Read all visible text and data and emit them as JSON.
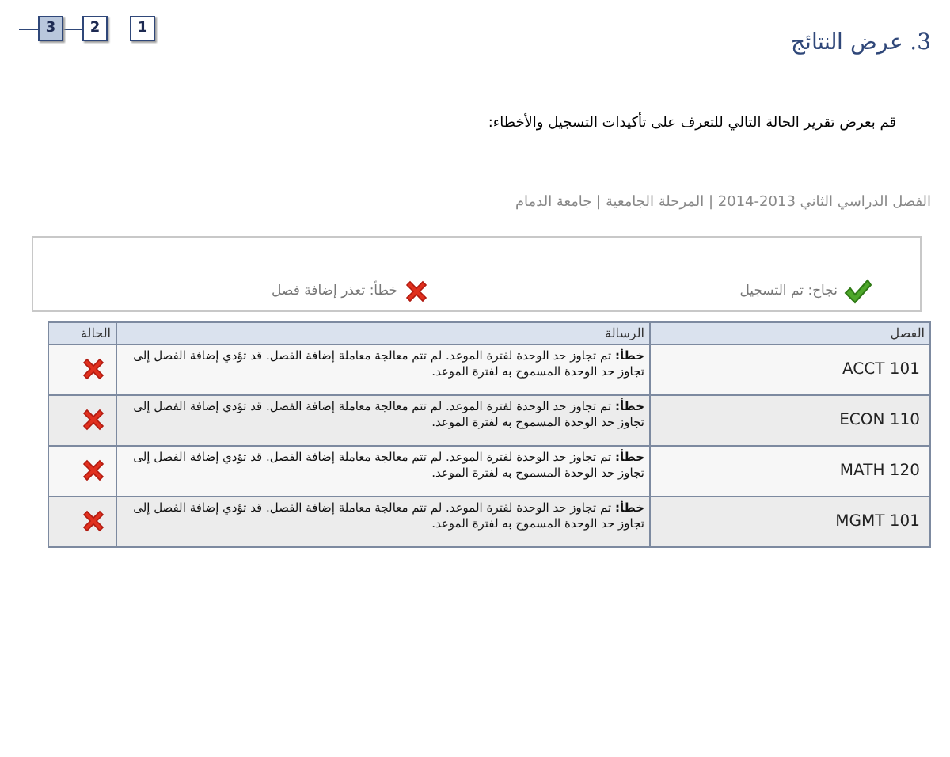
{
  "steps": [
    {
      "label": "1",
      "selected": false
    },
    {
      "label": "2",
      "selected": false
    },
    {
      "label": "3",
      "selected": true
    }
  ],
  "title": "3. عرض النتائج",
  "instruction": "قم بعرض تقرير الحالة التالي للتعرف على تأكيدات التسجيل والأخطاء:",
  "breadcrumb": "الفصل الدراسي الثاني 2013-2014 | المرحلة الجامعية | جامعة الدمام",
  "legend": [
    {
      "kind": "success",
      "text": "نجاح: تم التسجيل"
    },
    {
      "kind": "error",
      "text": "خطأ: تعذر إضافة فصل"
    }
  ],
  "table": {
    "columns": [
      "الفصل",
      "الرسالة",
      "الحالة"
    ],
    "rows": [
      {
        "class": "ACCT  101",
        "message": "**خطأ:** تم تجاوز حد الوحدة لفترة الموعد. لم تتم معالجة معاملة إضافة الفصل. قد تؤدي إضافة الفصل إلى تجاوز حد الوحدة المسموح به لفترة الموعد.",
        "kind": "error"
      },
      {
        "class": "ECON  110",
        "message": "**خطأ:** تم تجاوز حد الوحدة لفترة الموعد. لم تتم معالجة معاملة إضافة الفصل. قد تؤدي إضافة الفصل إلى تجاوز حد الوحدة المسموح به لفترة الموعد.",
        "kind": "error"
      },
      {
        "class": "MATH  120",
        "message": "**خطأ:** تم تجاوز حد الوحدة لفترة الموعد. لم تتم معالجة معاملة إضافة الفصل. قد تؤدي إضافة الفصل إلى تجاوز حد الوحدة المسموح به لفترة الموعد.",
        "kind": "error"
      },
      {
        "class": "MGMT  101",
        "message": "**خطأ:** تم تجاوز حد الوحدة لفترة الموعد. لم تتم معالجة معاملة إضافة الفصل. قد تؤدي إضافة الفصل إلى تجاوز حد الوحدة المسموح به لفترة الموعد.",
        "kind": "error"
      }
    ]
  }
}
